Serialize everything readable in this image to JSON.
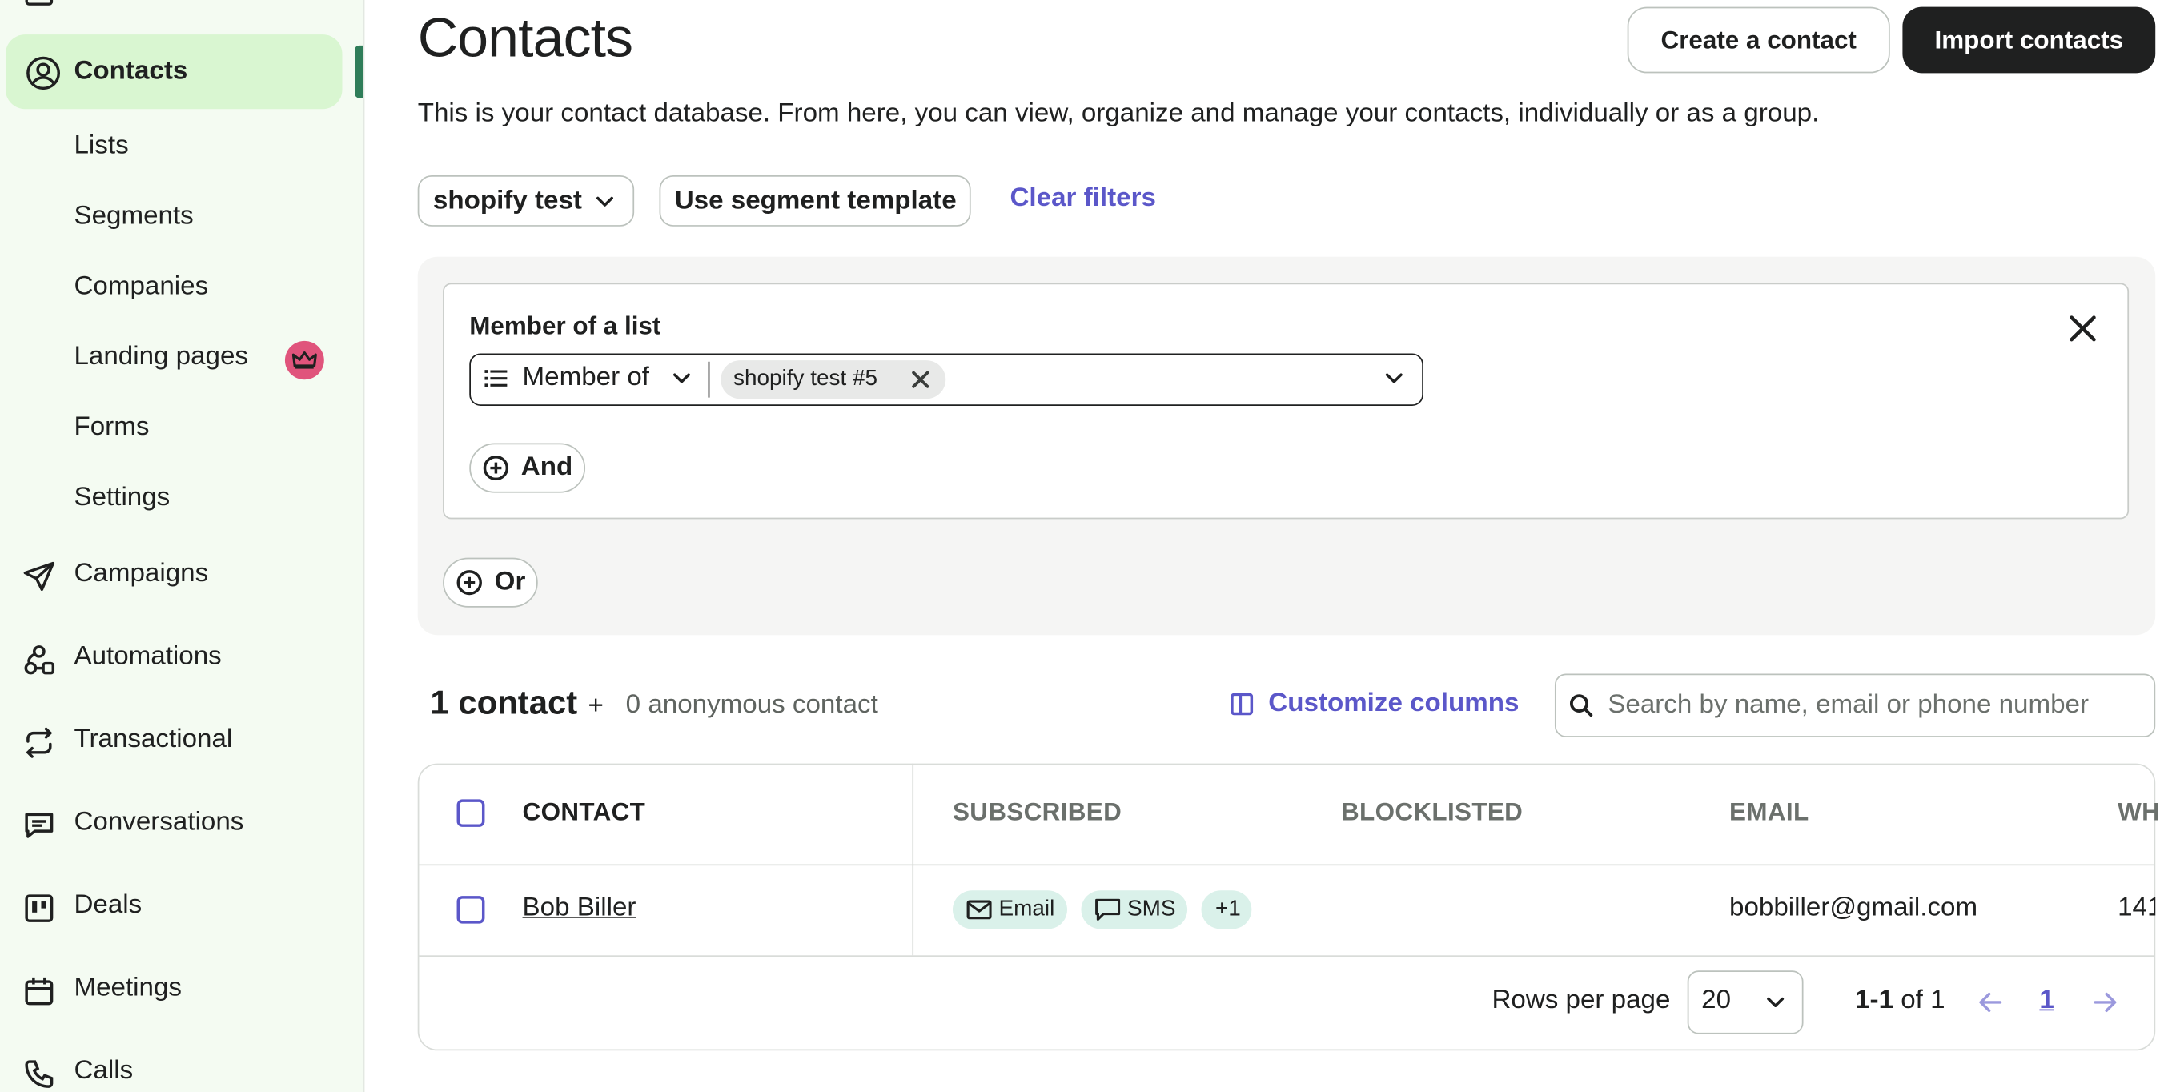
{
  "sidebar": {
    "active": {
      "label": "Contacts",
      "icon": "user-circle-icon"
    },
    "sub_items": [
      {
        "label": "Lists"
      },
      {
        "label": "Segments"
      },
      {
        "label": "Companies"
      },
      {
        "label": "Landing pages",
        "badge_icon": "crown-icon"
      },
      {
        "label": "Forms"
      },
      {
        "label": "Settings"
      }
    ],
    "items": [
      {
        "label": "Campaigns",
        "icon": "send-icon"
      },
      {
        "label": "Automations",
        "icon": "automation-icon"
      },
      {
        "label": "Transactional",
        "icon": "repeat-icon"
      },
      {
        "label": "Conversations",
        "icon": "chat-icon"
      },
      {
        "label": "Deals",
        "icon": "kanban-icon"
      },
      {
        "label": "Meetings",
        "icon": "calendar-icon"
      },
      {
        "label": "Calls",
        "icon": "phone-icon"
      }
    ]
  },
  "header": {
    "title": "Contacts",
    "create_label": "Create a contact",
    "import_label": "Import contacts",
    "description": "This is your contact database. From here, you can view, organize and manage your contacts, individually or as a group."
  },
  "filters": {
    "segment_label": "shopify test",
    "template_label": "Use segment template",
    "clear_label": "Clear filters",
    "condition_title": "Member of a list",
    "operator_label": "Member of",
    "chip_label": "shopify test #5",
    "and_label": "And",
    "or_label": "Or"
  },
  "summary": {
    "count": "1 contact",
    "plus": "+",
    "anonymous": "0 anonymous contact",
    "customize_label": "Customize columns",
    "search_placeholder": "Search by name, email or phone number"
  },
  "table": {
    "headers": {
      "contact": "CONTACT",
      "subscribed": "SUBSCRIBED",
      "blocklisted": "BLOCKLISTED",
      "email": "EMAIL",
      "wh": "WH"
    },
    "rows": [
      {
        "contact": "Bob Biller",
        "tags": [
          {
            "label": "Email",
            "icon": "mail-icon"
          },
          {
            "label": "SMS",
            "icon": "chat-icon"
          },
          {
            "label": "+1"
          }
        ],
        "email": "bobbiller@gmail.com",
        "wh": "141"
      }
    ]
  },
  "pagination": {
    "rows_label": "Rows per page",
    "rows_value": "20",
    "range_bold": "1-1",
    "range_rest": " of 1",
    "page": "1"
  },
  "colors": {
    "accent": "#5b57c9",
    "active_bg": "#d9f6d1",
    "sidebar_bg": "#f4fbf2",
    "dark": "#1f2020",
    "badge": "#e0547c",
    "tag": "#daf1ea"
  }
}
